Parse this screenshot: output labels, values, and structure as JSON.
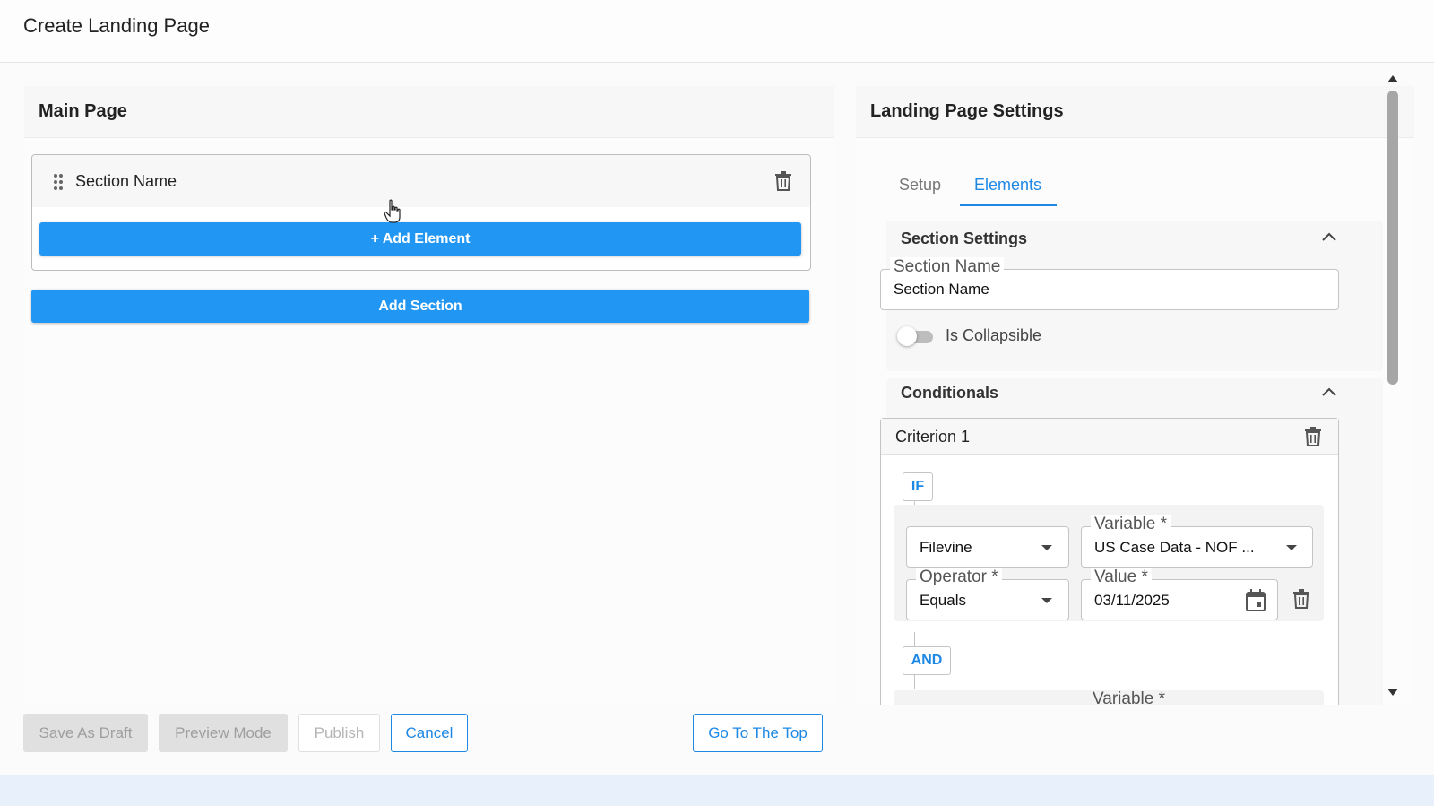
{
  "page": {
    "title": "Create Landing Page"
  },
  "main_page": {
    "title": "Main Page",
    "section": {
      "name": "Section Name",
      "add_element_label": "+ Add Element"
    },
    "add_section_label": "Add Section"
  },
  "settings": {
    "title": "Landing Page Settings",
    "tabs": [
      {
        "label": "Setup"
      },
      {
        "label": "Elements"
      }
    ],
    "active_tab": "Elements",
    "section_settings": {
      "title": "Section Settings",
      "section_name_label": "Section Name",
      "section_name_value": "Section Name",
      "collapsible_label": "Is Collapsible",
      "collapsible_on": false
    },
    "conditionals": {
      "title": "Conditionals",
      "criterion_title": "Criterion 1",
      "if_label": "IF",
      "and_label": "AND",
      "source_value": "Filevine",
      "variable_label": "Variable *",
      "variable_value": "US Case Data - NOF ...",
      "operator_label": "Operator *",
      "operator_value": "Equals",
      "value_label": "Value *",
      "value_value": "03/11/2025",
      "next_variable_label": "Variable *"
    }
  },
  "footer": {
    "save_draft": "Save As Draft",
    "preview_mode": "Preview Mode",
    "publish": "Publish",
    "cancel": "Cancel",
    "go_top": "Go To The Top"
  },
  "colors": {
    "primary": "#2196f3",
    "accent": "#1e88e5"
  }
}
